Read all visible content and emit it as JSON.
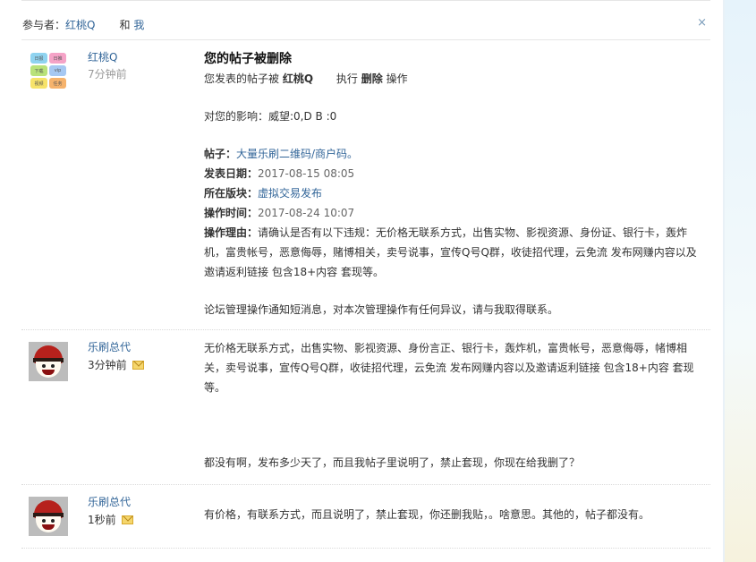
{
  "header": {
    "participants_prefix": "参与者：",
    "participant_1": "红桃Q",
    "and_label": "和",
    "participant_2": "我",
    "close_glyph": "×"
  },
  "messages": [
    {
      "username": "红桃Q",
      "time": "7分钟前",
      "title": "您的帖子被删除",
      "line_action_prefix": "您发表的帖子被",
      "line_action_user": "红桃Q",
      "line_action_exec": "执行",
      "line_action_op": "删除",
      "line_action_suffix": "操作",
      "impact": "对您的影响：威望:0,D B :0",
      "post_label": "帖子：",
      "post_title": "大量乐刷二维码/商户码。",
      "date_label": "发表日期：",
      "date_value": "2017-08-15 08:05",
      "board_label": "所在版块：",
      "board_value": "虚拟交易发布",
      "optime_label": "操作时间：",
      "optime_value": "2017-08-24 10:07",
      "reason_label": "操作理由：",
      "reason_value": "请确认是否有以下违规：无价格无联系方式，出售实物、影视资源、身份证、银行卡，轰炸机，富贵帐号，恶意侮辱，赌博相关，卖号说事，宣传Q号Q群，收徒招代理，云免流 发布网赚内容以及邀请返利链接 包含18+内容 套现等。",
      "footer": "论坛管理操作通知短消息，对本次管理操作有任何异议，请与我取得联系。"
    },
    {
      "username": "乐刷总代",
      "time": "3分钟前",
      "text_1": "无价格无联系方式，出售实物、影视资源、身份言正、银行卡，轰炸机，富贵帐号，恶意侮辱，帾博相关，卖号说事，宣传Q号Q群，收徒招代理，云免流 发布网赚内容以及邀请返利链接 包含18+内容 套现等。",
      "text_2": "都没有啊，发布多少天了，而且我帖子里说明了，禁止套现，你现在给我删了？"
    },
    {
      "username": "乐刷总代",
      "time": "1秒前",
      "text_1": "有价格，有联系方式，而且说明了，禁止套现，你还删我贴，。啥意思。其他的，帖子都没有。"
    }
  ],
  "avatar_tiles": [
    "日报",
    "日推",
    "下载",
    "vip",
    "视频",
    "任务"
  ],
  "colors": {
    "link": "#336699",
    "hat": "#b6211c"
  }
}
